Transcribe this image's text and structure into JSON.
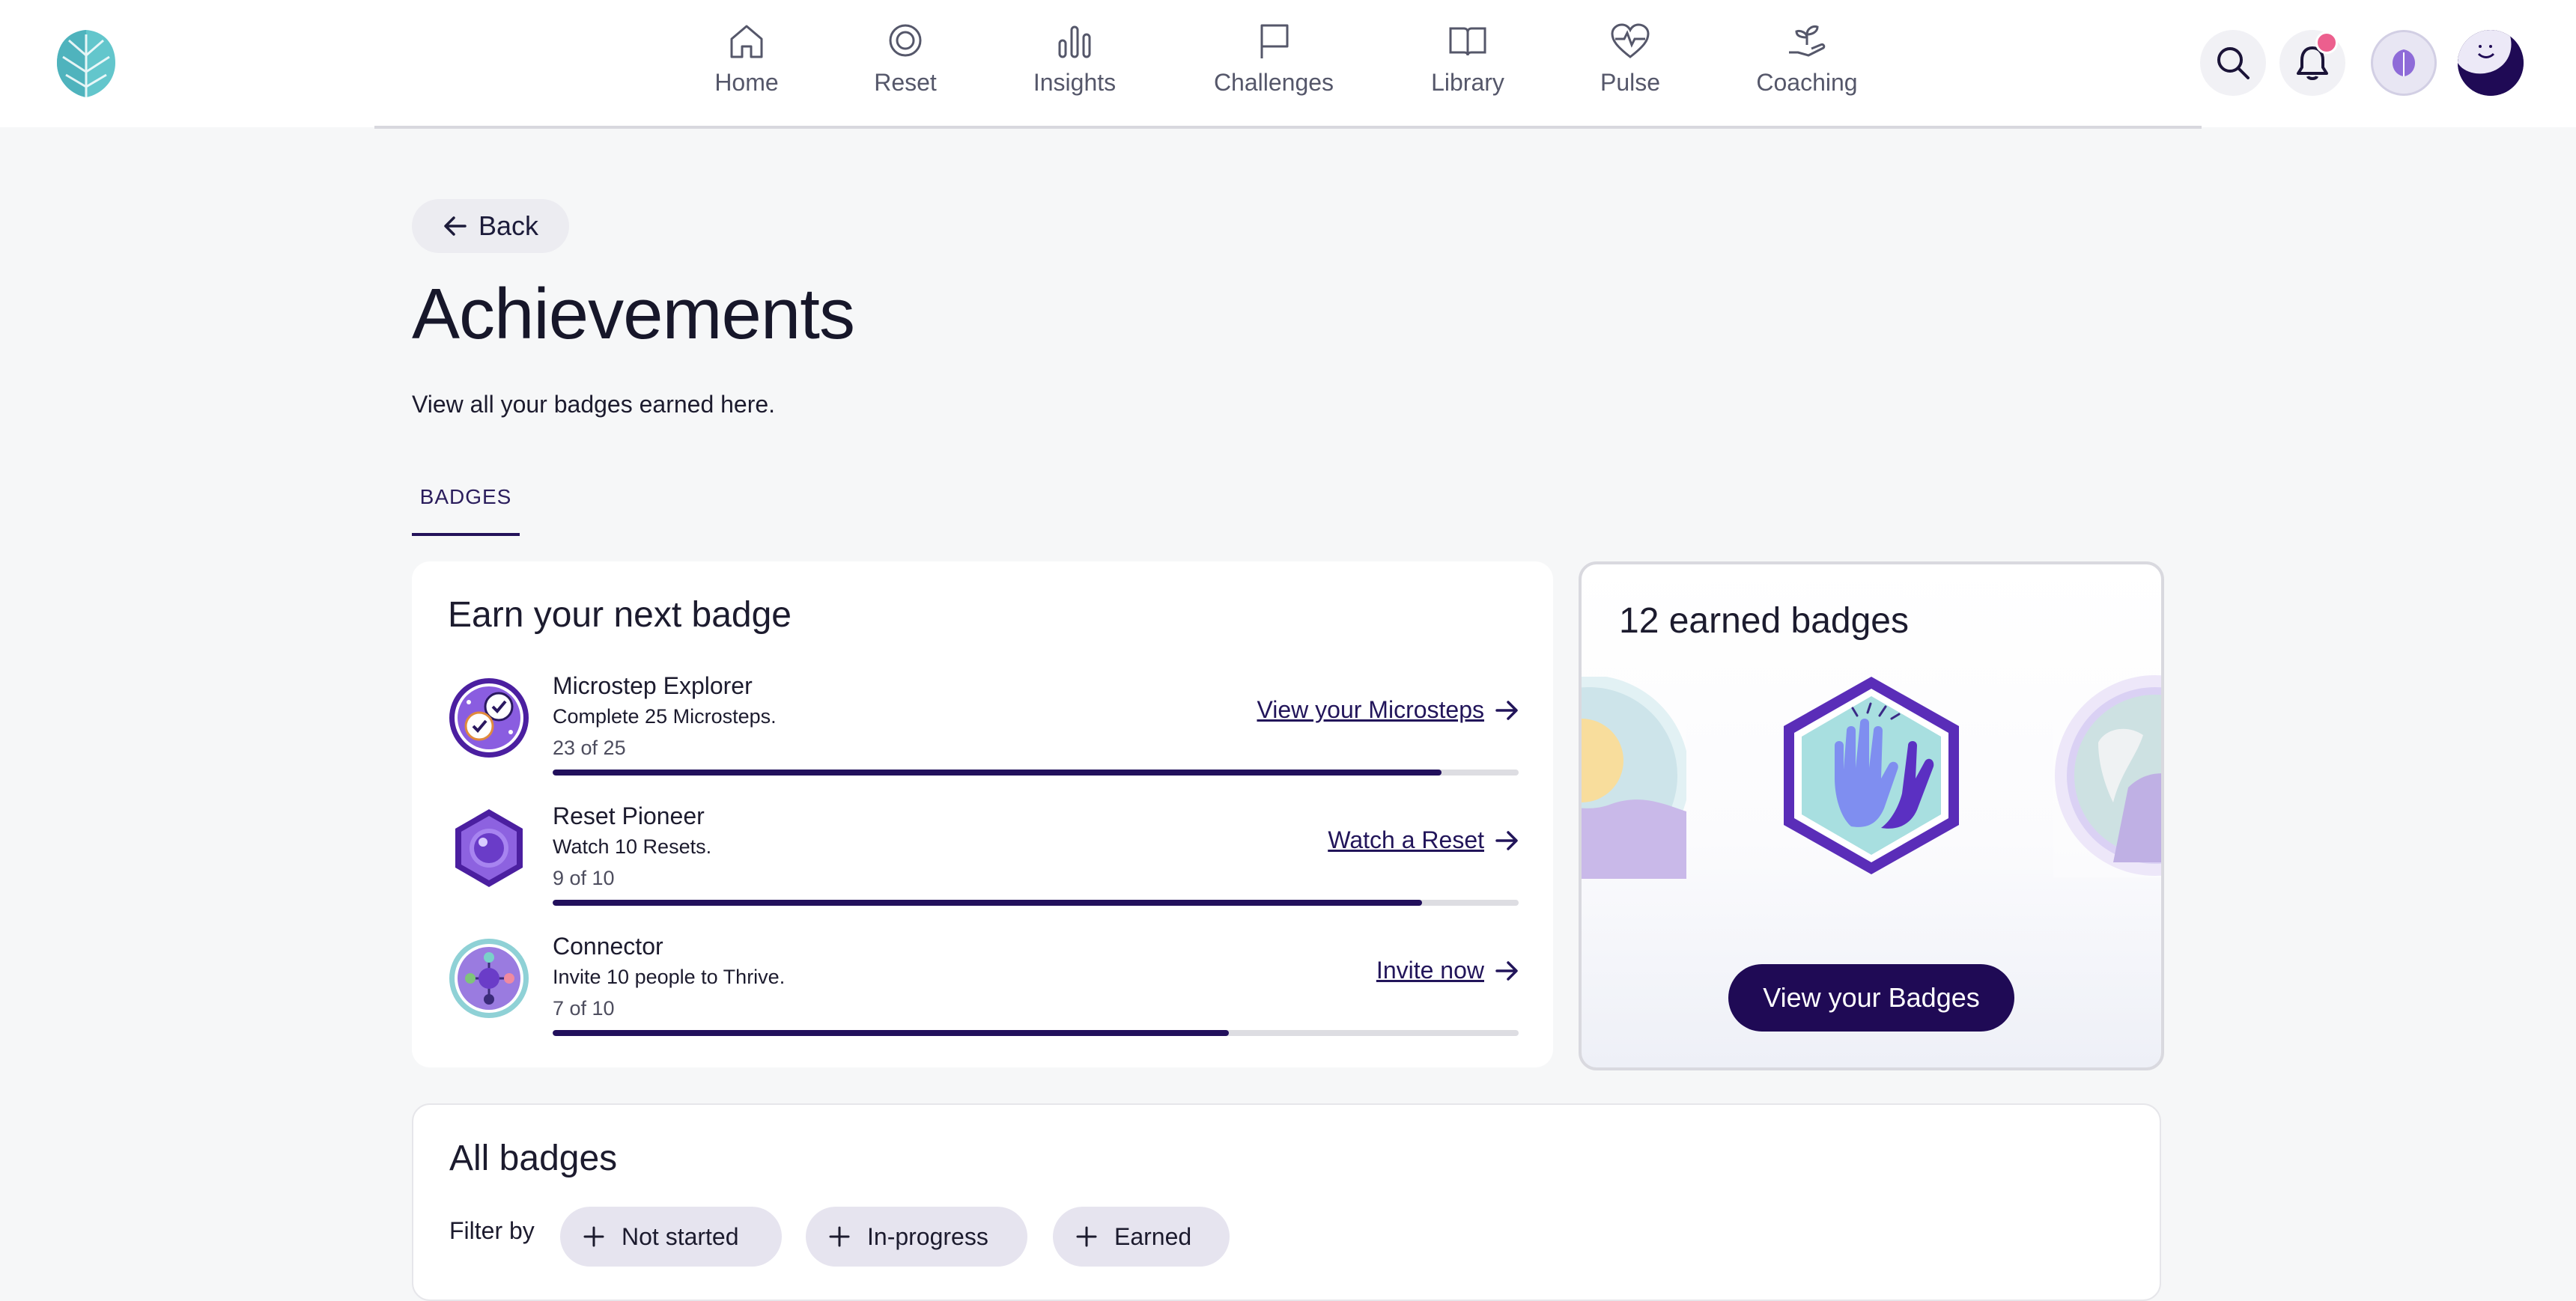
{
  "nav": {
    "items": [
      {
        "label": "Home",
        "icon": "home-icon"
      },
      {
        "label": "Reset",
        "icon": "reset-icon"
      },
      {
        "label": "Insights",
        "icon": "insights-icon"
      },
      {
        "label": "Challenges",
        "icon": "flag-icon"
      },
      {
        "label": "Library",
        "icon": "book-icon"
      },
      {
        "label": "Pulse",
        "icon": "heart-pulse-icon"
      },
      {
        "label": "Coaching",
        "icon": "coaching-icon"
      }
    ],
    "notification_dot_color": "#ec5f8e"
  },
  "back_label": "Back",
  "page": {
    "title": "Achievements",
    "subtitle": "View all your badges earned here."
  },
  "tabs": [
    {
      "label": "BADGES",
      "active": true
    }
  ],
  "next_badge": {
    "title": "Earn your next badge",
    "items": [
      {
        "name": "Microstep Explorer",
        "description": "Complete 25 Microsteps.",
        "progress_text": "23 of 25",
        "progress": 0.92,
        "link": "View your Microsteps",
        "icon": "microstep-badge-icon"
      },
      {
        "name": "Reset Pioneer",
        "description": "Watch 10 Resets.",
        "progress_text": "9 of 10",
        "progress": 0.9,
        "link": "Watch a Reset",
        "icon": "reset-badge-icon"
      },
      {
        "name": "Connector",
        "description": "Invite 10 people to Thrive.",
        "progress_text": "7 of 10",
        "progress": 0.7,
        "link": "Invite now",
        "icon": "connector-badge-icon"
      }
    ]
  },
  "earned": {
    "title": "12 earned badges",
    "button": "View your Badges"
  },
  "all_badges": {
    "title": "All badges",
    "filter_label": "Filter by",
    "filters": [
      "Not started",
      "In-progress",
      "Earned"
    ]
  },
  "colors": {
    "primary": "#1f0a55",
    "accent_purple": "#6b3fc4",
    "logo_teal": "#5cc4c8"
  }
}
